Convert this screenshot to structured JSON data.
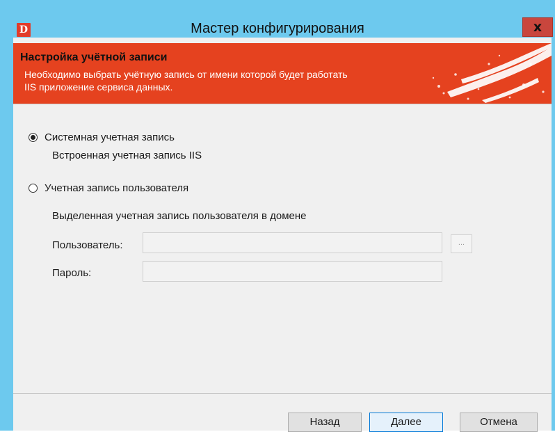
{
  "window": {
    "title": "Мастер конфигурирования",
    "app_icon_letter": "D",
    "close_glyph": "x",
    "accent_color": "#6dc9ee"
  },
  "header": {
    "title": "Настройка учётной записи",
    "description_line1": "Необходимо выбрать учётную запись от имени которой будет работать",
    "description_line2": "IIS приложение сервиса данных.",
    "banner_color": "#e5421f"
  },
  "options": {
    "system": {
      "label": "Системная учетная запись",
      "description": "Встроенная учетная запись IIS",
      "selected": true
    },
    "user": {
      "label": "Учетная запись пользователя",
      "description": "Выделенная учетная запись пользователя в домене",
      "selected": false
    }
  },
  "fields": {
    "user_label": "Пользователь:",
    "user_value": "",
    "browse_label": "...",
    "password_label": "Пароль:",
    "password_value": ""
  },
  "buttons": {
    "back": "Назад",
    "next": "Далее",
    "cancel": "Отмена"
  }
}
